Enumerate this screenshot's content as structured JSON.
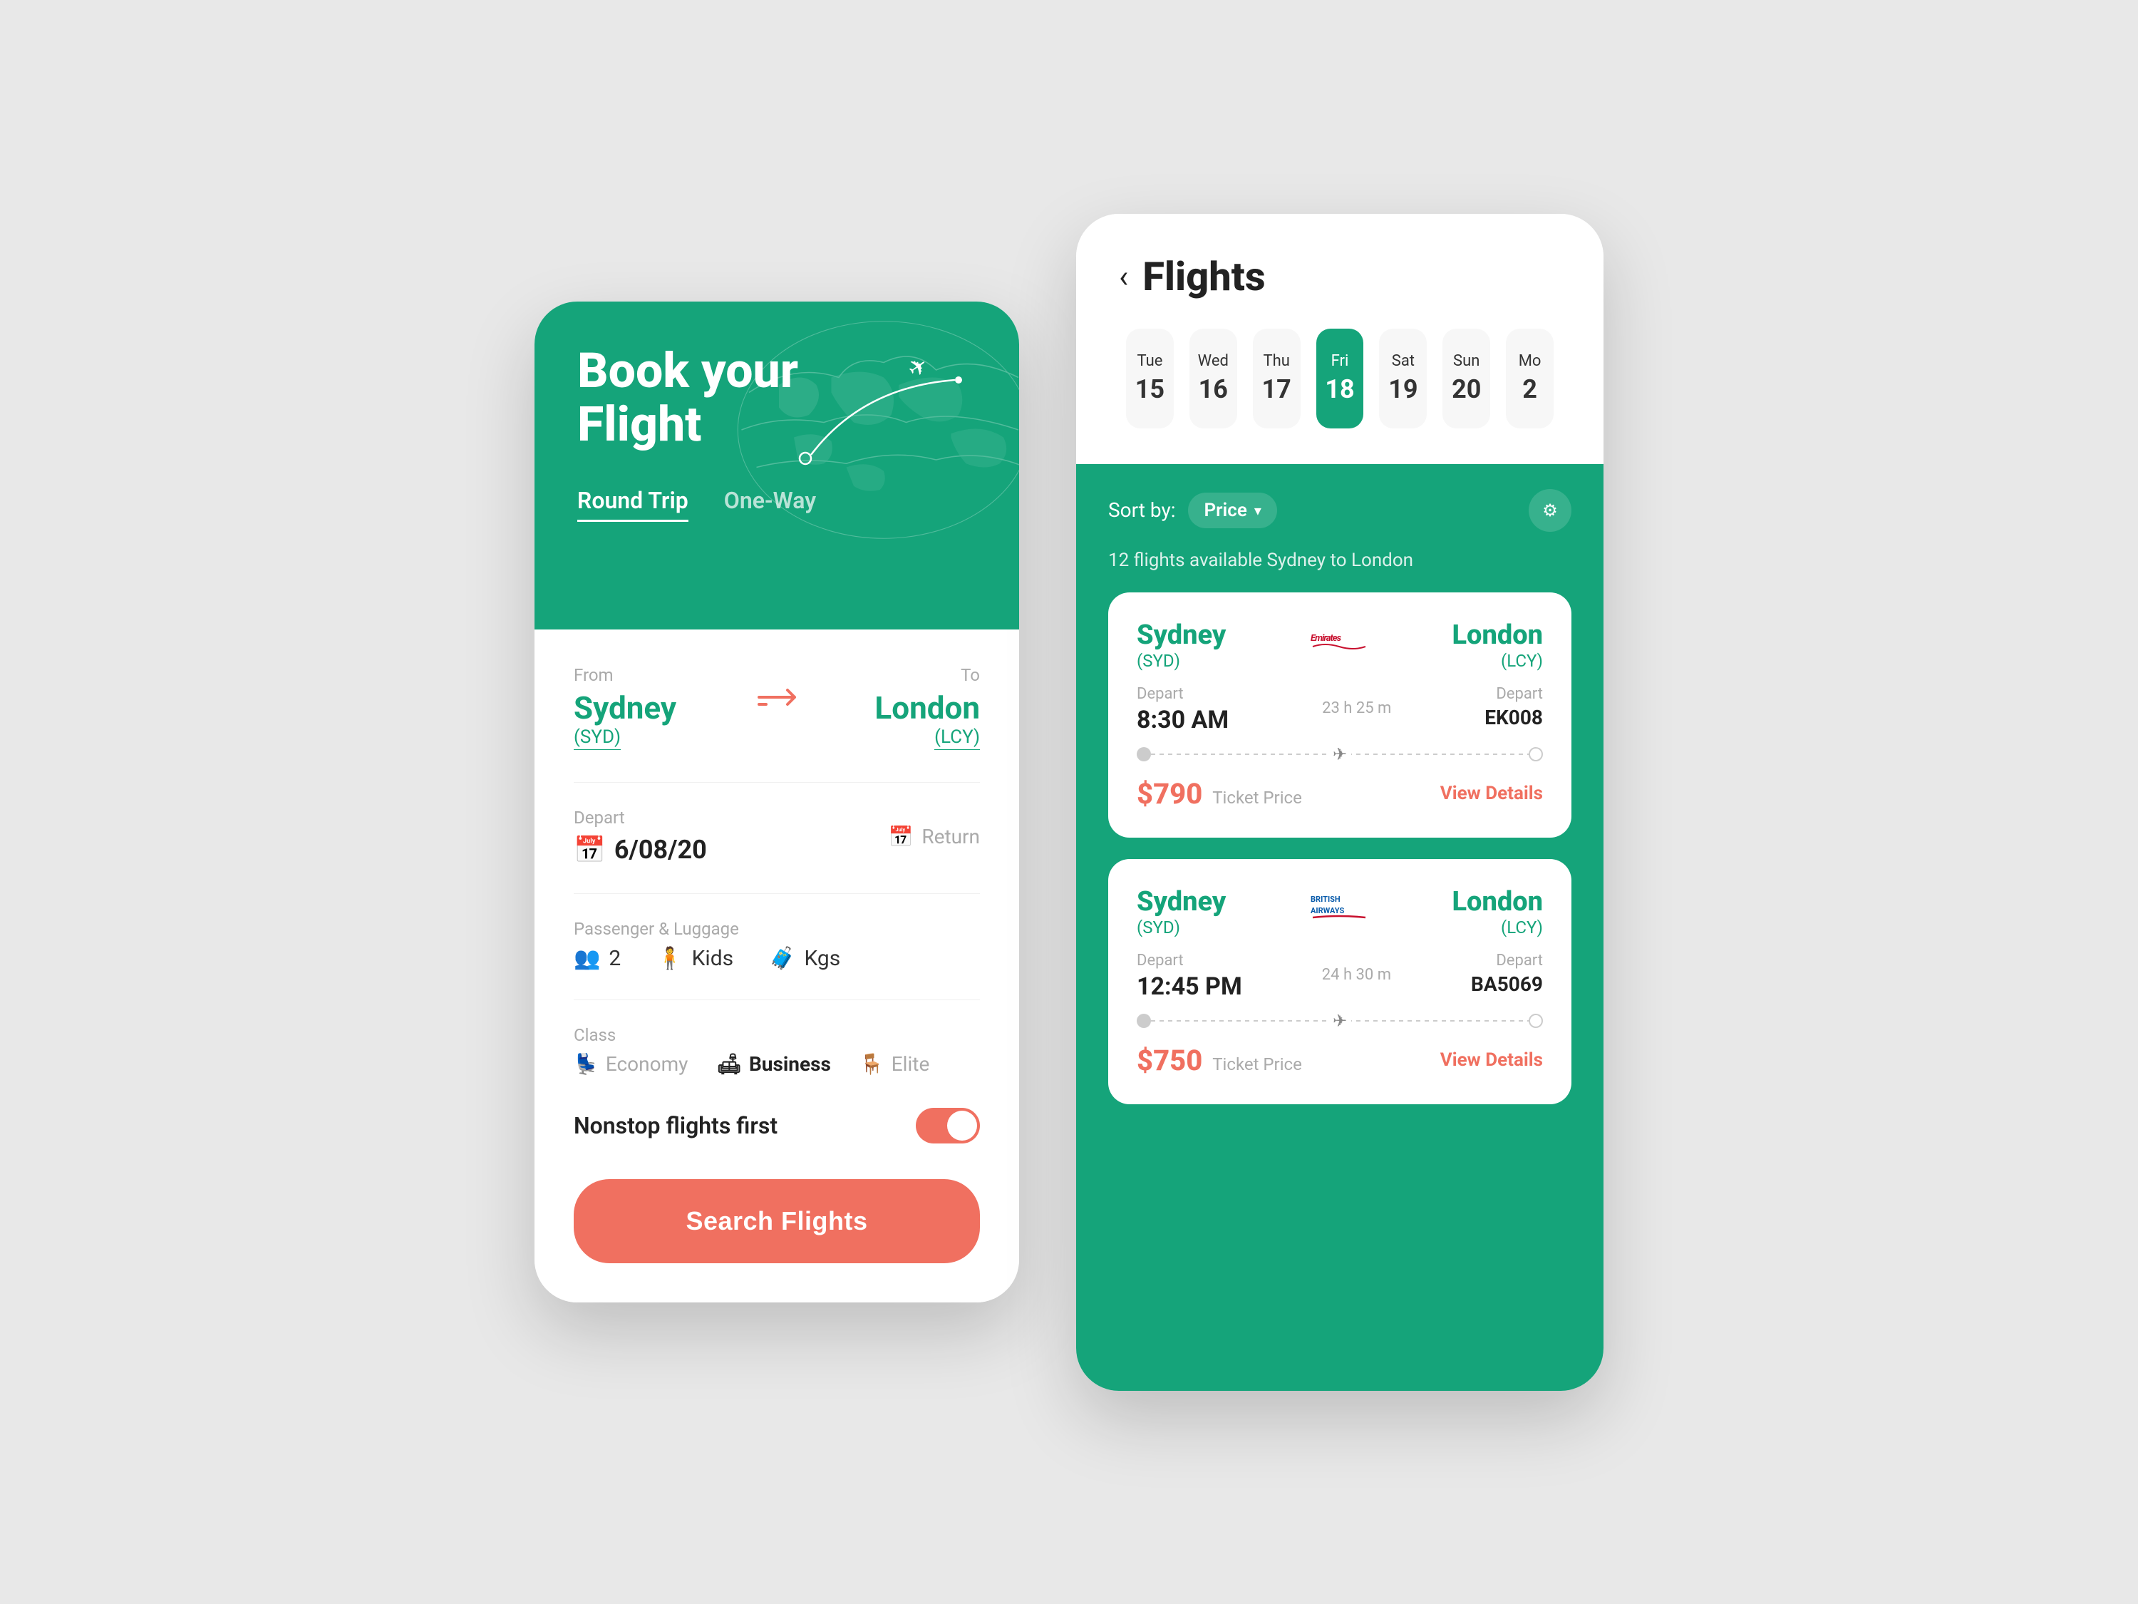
{
  "left_phone": {
    "header": {
      "title_line1": "Book  your",
      "title_line2": "Flight"
    },
    "tabs": [
      {
        "label": "Round Trip",
        "active": true
      },
      {
        "label": "One-Way",
        "active": false
      }
    ],
    "from_label": "From",
    "from_city": "Sydney",
    "from_code": "(SYD)",
    "to_label": "To",
    "to_city": "London",
    "to_code": "(LCY)",
    "depart_label": "Depart",
    "depart_date": "6/08/20",
    "return_label": "Return",
    "passenger_label": "Passenger & Luggage",
    "passengers": [
      {
        "icon": "👥",
        "value": "2"
      },
      {
        "icon": "🧍",
        "label": "Kids"
      },
      {
        "icon": "🧳",
        "label": "Kgs"
      }
    ],
    "class_label": "Class",
    "classes": [
      {
        "label": "Economy",
        "active": false
      },
      {
        "label": "Business",
        "active": true
      },
      {
        "label": "Elite",
        "active": false
      }
    ],
    "nonstop_label": "Nonstop flights first",
    "search_button": "Search Flights"
  },
  "right_phone": {
    "back_label": "‹",
    "page_title": "Flights",
    "dates": [
      {
        "day": "Tue",
        "num": "15",
        "active": false
      },
      {
        "day": "Wed",
        "num": "16",
        "active": false
      },
      {
        "day": "Thu",
        "num": "17",
        "active": false
      },
      {
        "day": "Fri",
        "num": "18",
        "active": true
      },
      {
        "day": "Sat",
        "num": "19",
        "active": false
      },
      {
        "day": "Sun",
        "num": "20",
        "active": false
      },
      {
        "day": "Mo",
        "num": "2",
        "active": false
      }
    ],
    "sort_label": "Sort by:",
    "sort_value": "Price",
    "available_text": "12 flights available Sydney to London",
    "flights": [
      {
        "from_city": "Sydney",
        "from_code": "(SYD)",
        "airline": "Emirates",
        "airline_sub": "",
        "to_city": "London",
        "to_code": "(LCY)",
        "depart_label": "Depart",
        "depart_time": "8:30 AM",
        "duration": "23 h 25 m",
        "flight_num_label": "Depart",
        "flight_num": "EK008",
        "price": "$790",
        "price_label": "Ticket Price",
        "view_label": "View Details"
      },
      {
        "from_city": "Sydney",
        "from_code": "(SYD)",
        "airline": "British Airways",
        "airline_sub": "",
        "to_city": "London",
        "to_code": "(LCY)",
        "depart_label": "Depart",
        "depart_time": "12:45 PM",
        "duration": "24 h 30 m",
        "flight_num_label": "Depart",
        "flight_num": "BA5069",
        "price": "$750",
        "price_label": "Ticket Price",
        "view_label": "View Details"
      }
    ]
  },
  "colors": {
    "teal": "#15a47a",
    "coral": "#f07060",
    "white": "#ffffff",
    "light_gray": "#f7f7f7"
  }
}
